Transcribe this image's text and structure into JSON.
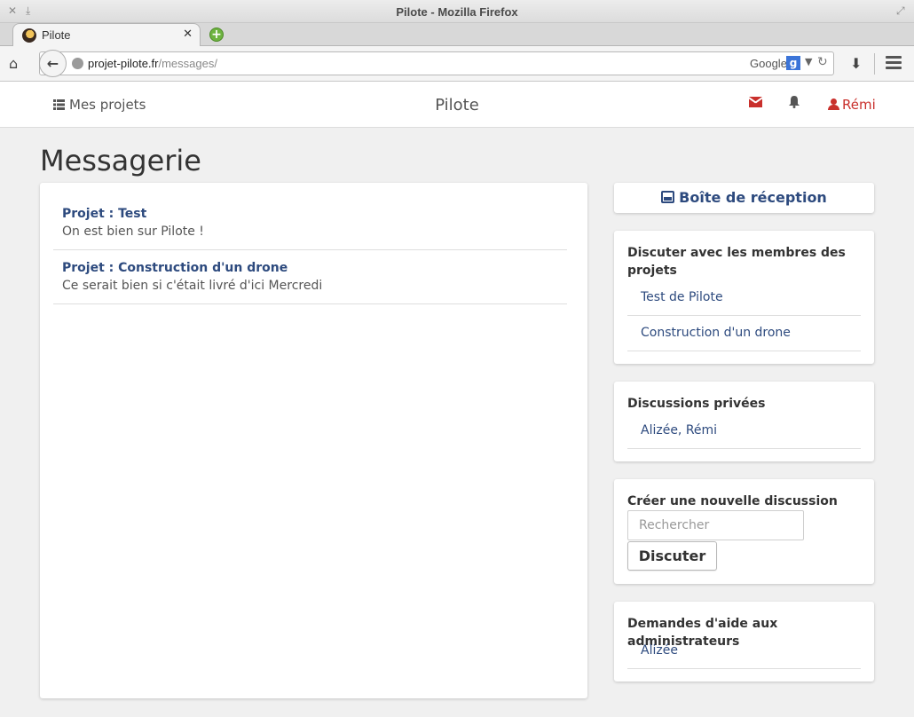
{
  "window": {
    "title": "Pilote - Mozilla Firefox",
    "controls": {
      "close": "✕",
      "minimize": "⤓",
      "maximize": "⤢"
    }
  },
  "browser": {
    "tab": {
      "title": "Pilote",
      "close": "✕"
    },
    "new_tab_icon": "+",
    "url_host": "projet-pilote.fr",
    "url_path": "/messages/",
    "search_engine": "Google",
    "search_engine_logo": "g",
    "icons": [
      "home-icon",
      "back-arrow-icon",
      "globe-icon",
      "dropdown-icon",
      "reload-icon",
      "download-icon",
      "hamburger-menu-icon"
    ],
    "glyphs": {
      "home": "⌂",
      "back": "←",
      "dropdown": "▼",
      "reload": "↻",
      "download": "⬇"
    }
  },
  "site": {
    "nav_projects": "Mes projets",
    "brand": "Pilote",
    "user_name": "Rémi",
    "bell_glyph": "🔔",
    "accent_color": "#c9302c",
    "link_color": "#2d4a7e"
  },
  "page": {
    "title": "Messagerie",
    "threads": [
      {
        "project": "Projet : Test",
        "last_message": "On est bien sur Pilote !"
      },
      {
        "project": "Projet : Construction d'un drone",
        "last_message": "Ce serait bien si c'était livré d'ici Mercredi"
      }
    ]
  },
  "sidebar": {
    "inbox_label": "Boîte de réception",
    "members": {
      "title": "Discuter avec les membres des projets",
      "links": [
        "Test de Pilote",
        "Construction d'un drone"
      ]
    },
    "private": {
      "title": "Discussions privées",
      "links": [
        "Alizée, Rémi"
      ]
    },
    "new_discussion": {
      "title": "Créer une nouvelle discussion",
      "search_placeholder": "Rechercher",
      "button_label": "Discuter"
    },
    "admin_help": {
      "title": "Demandes d'aide aux administrateurs",
      "links": [
        "Alizée"
      ]
    }
  }
}
